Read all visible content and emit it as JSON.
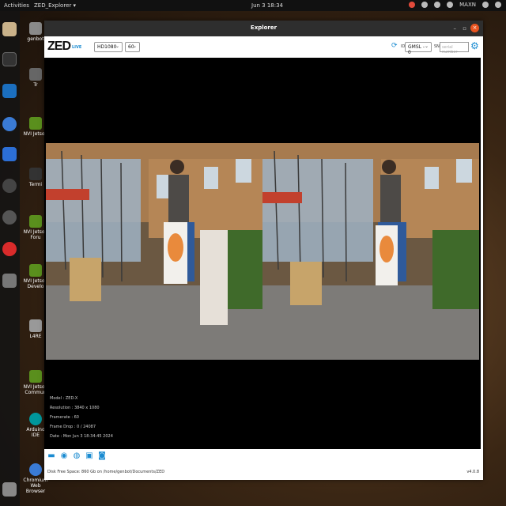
{
  "topbar": {
    "activities": "Activities",
    "app_menu": "ZED_Explorer ▾",
    "clock": "Jun 3  18:34",
    "power_mode": "MAXN"
  },
  "desktop": {
    "icons": [
      {
        "label": "genbot"
      },
      {
        "label": "Tr"
      },
      {
        "label": "NVI Jetson"
      },
      {
        "label": "Termi"
      },
      {
        "label": "NVI Jetson Foru"
      },
      {
        "label": "NVI Jetson Develo"
      },
      {
        "label": "L4RE"
      },
      {
        "label": "NVI Jetson Commun"
      },
      {
        "label": "Arduino IDE"
      },
      {
        "label": "Chromium Web Browser"
      }
    ]
  },
  "window": {
    "title": "Explorer",
    "logo": "ZED",
    "live": "LIVE",
    "resolution": "HD1080",
    "fps": "60",
    "id_label": "ID",
    "id_value": "GMSL - 0",
    "sn_label": "SN",
    "sn_placeholder": "serial number",
    "info": {
      "model": "Model : ZED-X",
      "resolution": "Resolution : 3840 x 1080",
      "framerate": "Framerate : 60",
      "frame_drop": "Frame Drop : 0 / 24087",
      "date": "Date : Mon Jun 3 18:34:45 2024"
    },
    "disk": "Disk Free Space: 860 Gb  on  /home/genbot/Documents/ZED",
    "version": "v4.0.8"
  },
  "icons": {
    "folder": "folder-icon",
    "stream": "stream-icon",
    "depth": "depth-icon",
    "record": "record-icon",
    "snapshot": "camera-icon",
    "settings": "gear-icon",
    "refresh": "refresh-icon"
  },
  "colors": {
    "accent": "#1a8bd1",
    "close": "#e95420",
    "titlebar": "#2e2e2e"
  }
}
